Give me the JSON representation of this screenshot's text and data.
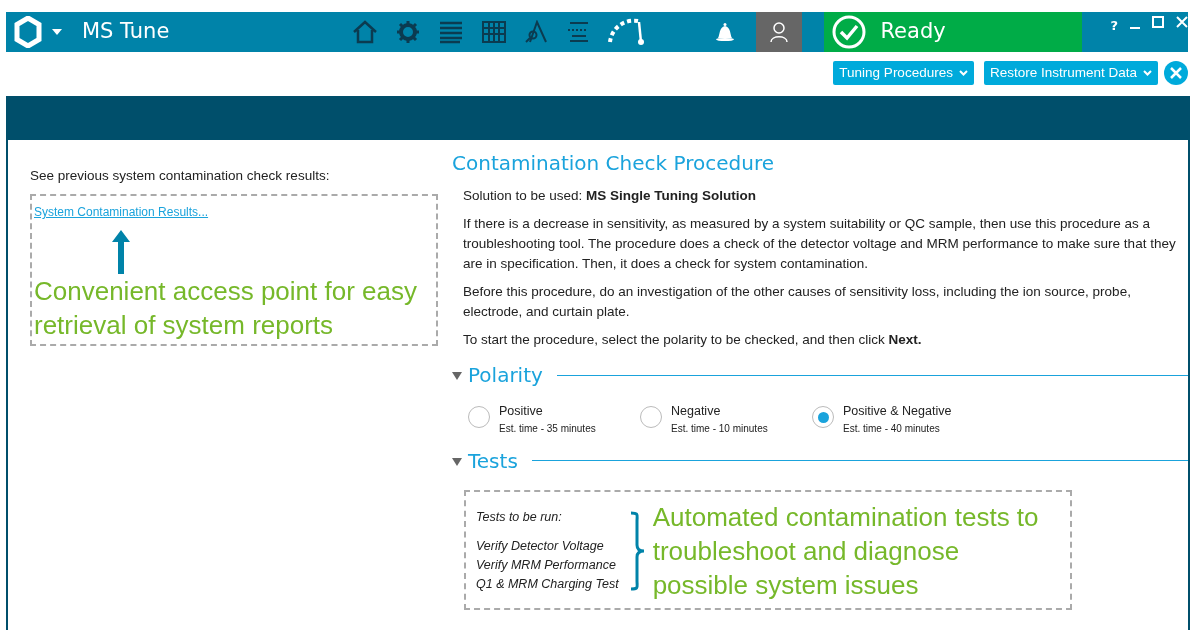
{
  "app": {
    "title": "MS Tune"
  },
  "status": {
    "text": "Ready"
  },
  "help_label": "?",
  "action_buttons": [
    {
      "label": "Tuning Procedures"
    },
    {
      "label": "Restore Instrument Data"
    }
  ],
  "left_panel": {
    "heading": "See previous system contamination check results:",
    "link": "System Contamination Results...",
    "annotation": "Convenient access point for easy retrieval of system reports"
  },
  "procedure": {
    "title": "Contamination Check Procedure",
    "solution": "Solution to be used: **MS Single Tuning Solution**",
    "paragraphs": [
      "If there is a decrease in sensitivity, as measured by a system suitability or QC sample, then use this procedure as a troubleshooting tool. The procedure does a check of the detector voltage and MRM performance to make sure that they are in specification. Then, it does a check for system contamination.",
      "Before this procedure, do an investigation of the other causes of sensitivity loss, including the ion source, probe, electrode, and curtain plate.",
      "To start the procedure, select the polarity to be checked, and then click  **Next.**"
    ]
  },
  "polarity": {
    "title": "Polarity",
    "expanded": true,
    "options": [
      {
        "label": "Positive",
        "time": "Est. time - 35 minutes",
        "selected": false
      },
      {
        "label": "Negative",
        "time": "Est. time - 10 minutes",
        "selected": false
      },
      {
        "label": "Positive & Negative",
        "time": "Est. time - 40 minutes",
        "selected": true
      }
    ]
  },
  "tests": {
    "title": "Tests",
    "expanded": true,
    "heading": "Tests to be run:",
    "items": [
      "Verify Detector Voltage",
      "Verify MRM Performance",
      "Q1 & MRM Charging Test"
    ],
    "annotation": "Automated contamination tests to troubleshoot and diagnose possible system issues"
  }
}
